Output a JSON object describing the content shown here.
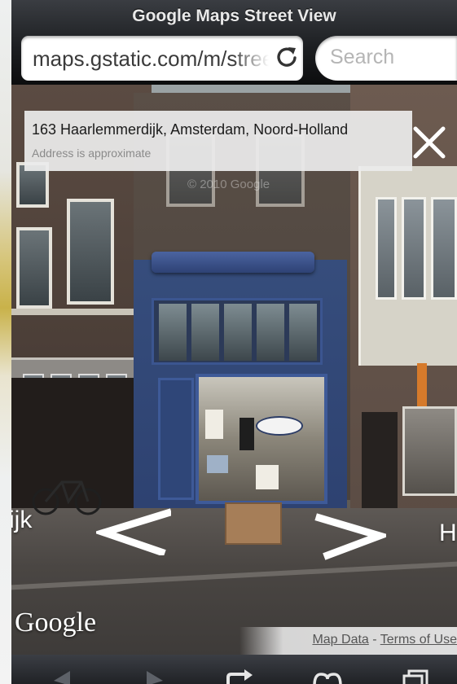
{
  "browser": {
    "title": "Google Maps Street View",
    "url": "maps.gstatic.com/m/streetview",
    "search_placeholder": "Search"
  },
  "streetview": {
    "address": "163 Haarlemmerdijk, Amsterdam, Noord-Holland",
    "address_note": "Address is approximate",
    "watermark": "© 2010 Google",
    "street_left": "ijk",
    "street_right": "H",
    "logo": "Google",
    "map_data_link": "Map Data",
    "separator": " - ",
    "terms_link": "Terms of Use"
  },
  "icons": {
    "reload": "reload-icon",
    "close": "close-icon",
    "arrow_left": "arrow-left-icon",
    "arrow_right": "arrow-right-icon",
    "back": "back-icon",
    "forward": "forward-icon",
    "share": "share-icon",
    "bookmarks": "bookmarks-icon",
    "tabs": "tabs-icon"
  },
  "colors": {
    "toolbar": "#2b2d31",
    "shopfront_blue": "#2d4170",
    "panel": "#ececec"
  }
}
